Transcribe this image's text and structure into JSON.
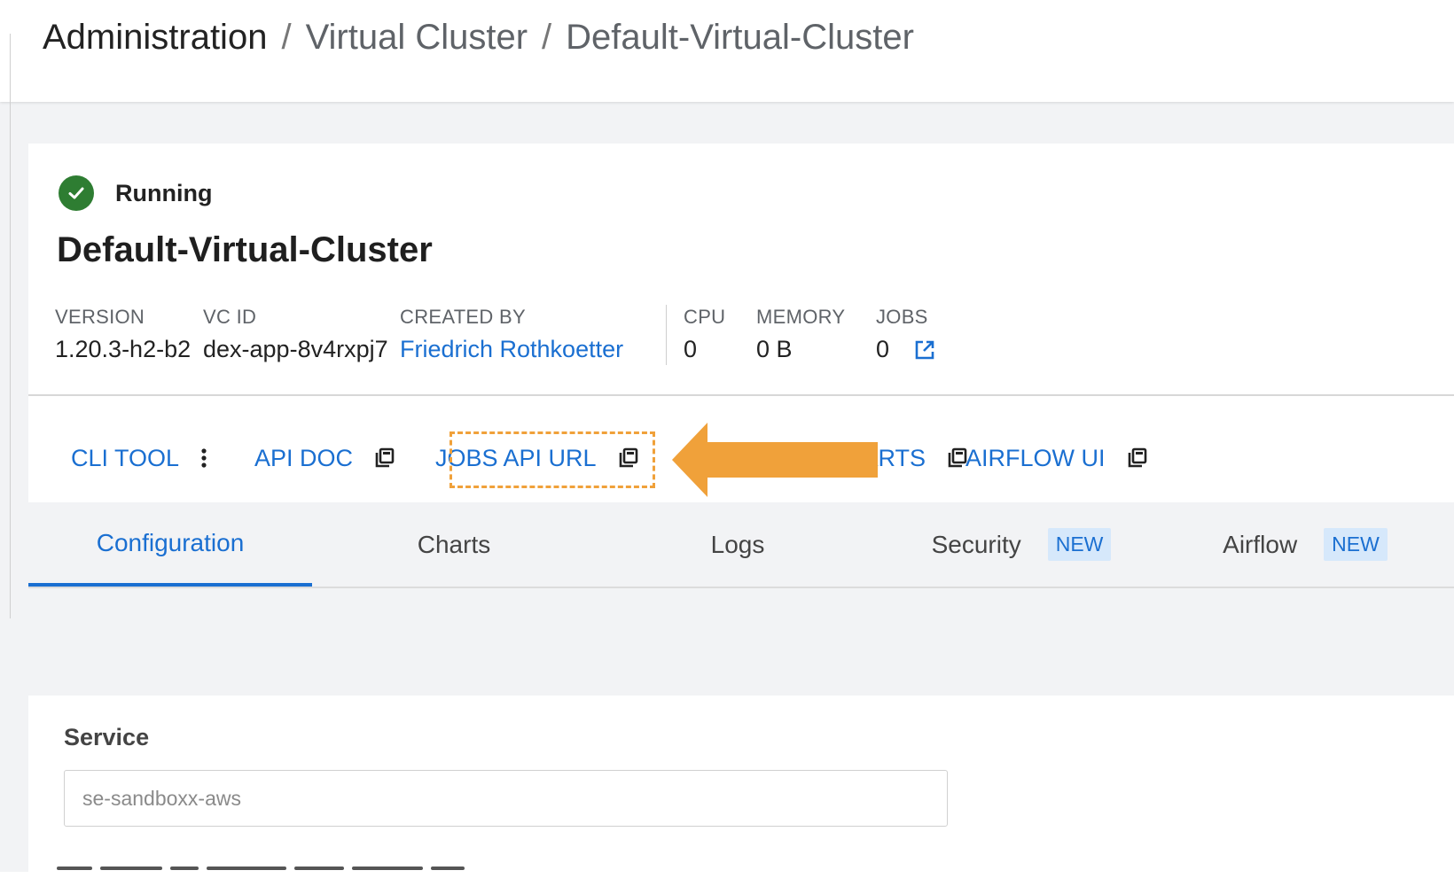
{
  "breadcrumb": {
    "items": [
      "Administration",
      "Virtual Cluster",
      "Default-Virtual-Cluster"
    ],
    "separator": "/"
  },
  "status": {
    "text": "Running",
    "color": "#2e7d32",
    "icon": "check-circle-icon"
  },
  "cluster": {
    "title": "Default-Virtual-Cluster"
  },
  "meta": {
    "version": {
      "label": "VERSION",
      "value": "1.20.3-h2-b2"
    },
    "vc_id": {
      "label": "VC ID",
      "value": "dex-app-8v4rxpj7"
    },
    "created_by": {
      "label": "CREATED BY",
      "value": "Friedrich Rothkoetter"
    },
    "cpu": {
      "label": "CPU",
      "value": "0"
    },
    "memory": {
      "label": "MEMORY",
      "value": "0 B"
    },
    "jobs": {
      "label": "JOBS",
      "value": "0",
      "icon": "external-link-icon"
    }
  },
  "actions": {
    "cli_tool": {
      "label": "CLI TOOL",
      "icon": "kebab-menu-icon"
    },
    "api_doc": {
      "label": "API DOC",
      "icon": "copy-icon"
    },
    "jobs_api_url": {
      "label": "JOBS API URL",
      "icon": "copy-icon"
    },
    "grafana_charts": {
      "label": "HARTS",
      "icon": "copy-icon"
    },
    "airflow_ui": {
      "label": "AIRFLOW UI",
      "icon": "copy-icon"
    }
  },
  "annotation": {
    "highlight_color": "#f0a13a",
    "arrow_color": "#f0a13a"
  },
  "tabs": [
    {
      "label": "Configuration",
      "active": true
    },
    {
      "label": "Charts"
    },
    {
      "label": "Logs"
    },
    {
      "label": "Security",
      "badge": "NEW"
    },
    {
      "label": "Airflow",
      "badge": "NEW"
    }
  ],
  "config": {
    "service_label": "Service",
    "service_value": "se-sandboxx-aws"
  },
  "colors": {
    "accent": "#1a6fd1",
    "background": "#f2f3f5"
  }
}
